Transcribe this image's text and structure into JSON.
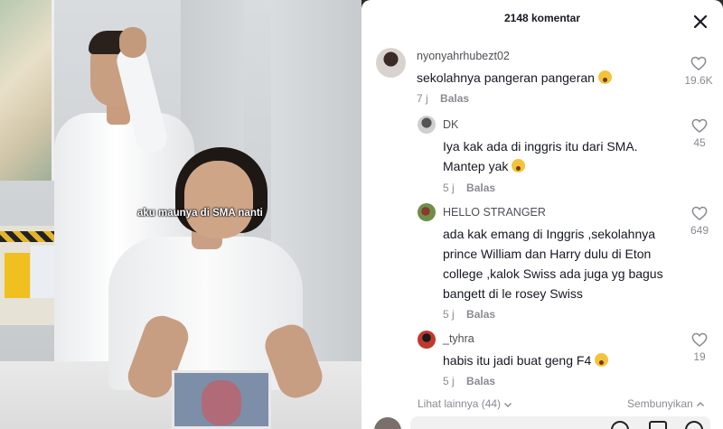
{
  "video": {
    "caption": "aku maunya di SMA nanti"
  },
  "panel": {
    "title": "2148 komentar",
    "close_icon": "close-icon"
  },
  "comments": [
    {
      "user": "nyonyahrhubezt02",
      "text": "sekolahnya pangeran pangeran",
      "emoji": "hushed-face-emoji",
      "time": "7 j",
      "reply_label": "Balas",
      "likes": "19.6K"
    },
    {
      "user": "DK",
      "text": "Iya kak ada di inggris itu dari SMA. Mantep yak",
      "emoji": "tears-of-joy-emoji",
      "time": "5 j",
      "reply_label": "Balas",
      "likes": "45"
    },
    {
      "user": "HELLO STRANGER",
      "text": "ada kak emang di Inggris ,sekolahnya prince William dan Harry dulu di Eton college ,kalok Swiss ada juga yg bagus bangett di le rosey Swiss",
      "time": "5 j",
      "reply_label": "Balas",
      "likes": "649"
    },
    {
      "user": "_tyhra",
      "text": "habis itu jadi buat geng F4",
      "emoji": "grinning-sweat-emoji",
      "time": "5 j",
      "reply_label": "Balas",
      "likes": "19"
    }
  ],
  "footer": {
    "more_label": "Lihat lainnya (44)",
    "hide_label": "Sembunyikan"
  },
  "colors": {
    "text_primary": "#161823",
    "text_secondary": "#8a8b91",
    "panel_bg": "#ffffff"
  }
}
